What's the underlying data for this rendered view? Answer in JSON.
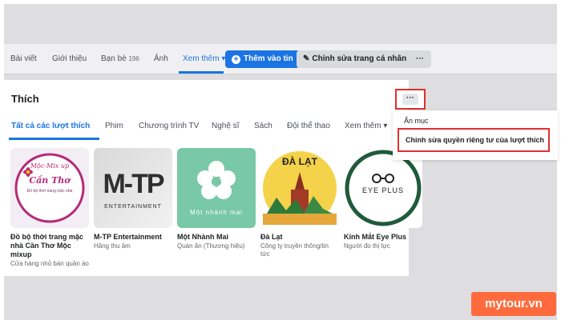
{
  "profile_nav": {
    "tabs": [
      {
        "label": "Bài viết"
      },
      {
        "label": "Giới thiệu"
      },
      {
        "label": "Bạn bè",
        "count": "196"
      },
      {
        "label": "Ảnh"
      },
      {
        "label": "Xem thêm ▾"
      }
    ],
    "add_story_label": "Thêm vào tin",
    "edit_profile_label": "Chỉnh sửa trang cá nhân",
    "more_label": "···"
  },
  "likes": {
    "title": "Thích",
    "more_label": "···",
    "subtabs": [
      "Tất cả các lượt thích",
      "Phim",
      "Chương trình TV",
      "Nghệ sĩ",
      "Sách",
      "Đội thể thao",
      "Xem thêm ▾"
    ],
    "cards": [
      {
        "name": "Đồ bộ thời trang mặc nhà Cần Thơ Mộc mixup",
        "category": "Cửa hàng nhỏ bán quần áo",
        "img_line1": "Mộc-Mix up",
        "img_line2": "Cần Thơ",
        "img_line3": "Đồ bộ thời trang mặc nhà"
      },
      {
        "name": "M-TP Entertainment",
        "category": "Hãng thu âm",
        "img_line1": "M-TP",
        "img_line2": "ENTERTAINMENT"
      },
      {
        "name": "Một Nhành Mai",
        "category": "Quán ăn (Thương hiệu)",
        "img_line1": "Một nhành mai"
      },
      {
        "name": "Đà Lạt",
        "category": "Công ty truyền thông/tin tức",
        "img_line1": "ĐÀ LẠT"
      },
      {
        "name": "Kính Mắt Eye Plus",
        "category": "Người đo thị lực",
        "img_line1": "EYE PLUS"
      }
    ]
  },
  "menu": {
    "hide_label": "Ẩn mục",
    "edit_privacy_label": "Chỉnh sửa quyền riêng tư của lượt thích"
  },
  "watermark": {
    "text": "mytour.vn"
  },
  "colors": {
    "accent": "#1b74e4",
    "highlight": "#e0302e",
    "watermark": "#ff6b3d"
  }
}
